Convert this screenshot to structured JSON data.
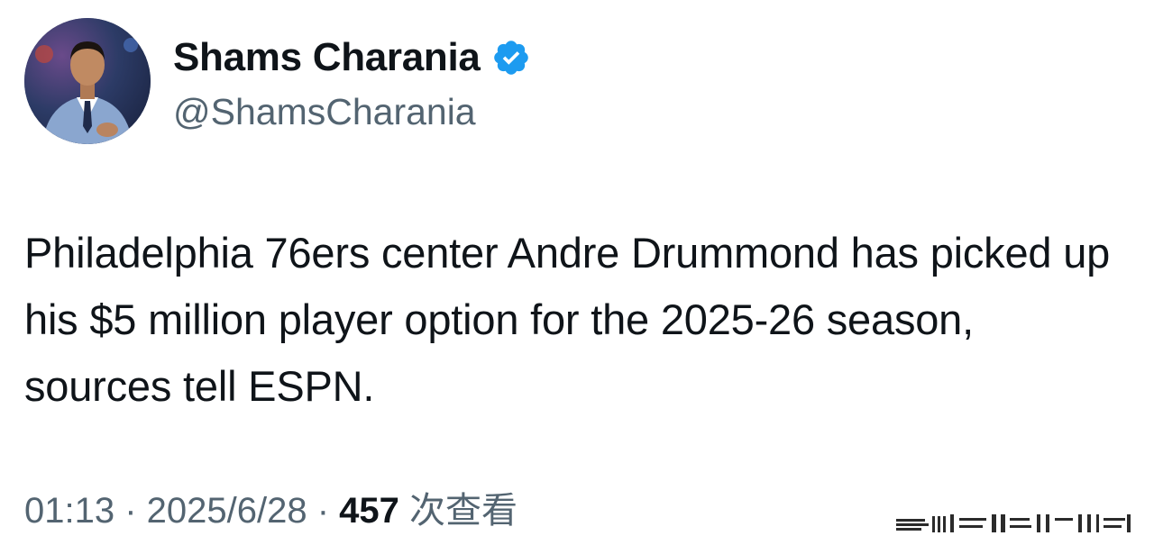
{
  "author": {
    "display_name": "Shams Charania",
    "handle": "@ShamsCharania",
    "verified": true,
    "verified_color": "#1d9bf0",
    "avatar_icon": "profile-photo"
  },
  "tweet": {
    "text": "Philadelphia 76ers center Andre Drummond has picked up his $5 million player option for the 2025-26 season, sources tell ESPN."
  },
  "meta": {
    "time": "01:13",
    "separator": " · ",
    "date": "2025/6/28",
    "views_count": "457",
    "views_label": " 次查看"
  },
  "colors": {
    "text_primary": "#0f1419",
    "text_secondary": "#536471",
    "background": "#ffffff"
  }
}
